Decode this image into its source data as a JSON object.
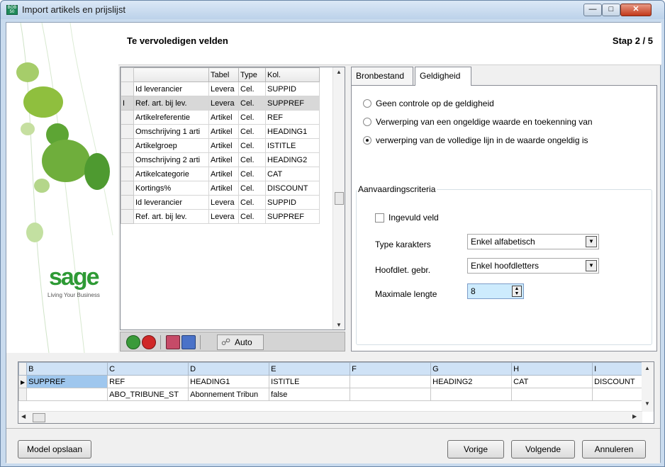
{
  "window": {
    "title": "Import artikels en prijslijst",
    "app_icon_text": "BOB 50"
  },
  "header": {
    "step_title": "Te vervoledigen velden",
    "step_number": "Stap  2 / 5"
  },
  "branding": {
    "logo": "sage",
    "tagline": "Living Your Business"
  },
  "fields_grid": {
    "columns": [
      "Tabel",
      "Type",
      "Kol."
    ],
    "rows": [
      {
        "name": "Id leverancier",
        "table": "Levera",
        "type": "Cel.",
        "col": "SUPPID"
      },
      {
        "name": "Ref. art. bij lev.",
        "table": "Levera",
        "type": "Cel.",
        "col": "SUPPREF"
      },
      {
        "name": "Artikelreferentie",
        "table": "Artikel",
        "type": "Cel.",
        "col": "REF"
      },
      {
        "name": "Omschrijving 1 arti",
        "table": "Artikel",
        "type": "Cel.",
        "col": "HEADING1"
      },
      {
        "name": "Artikelgroep",
        "table": "Artikel",
        "type": "Cel.",
        "col": "ISTITLE"
      },
      {
        "name": "Omschrijving 2 arti",
        "table": "Artikel",
        "type": "Cel.",
        "col": "HEADING2"
      },
      {
        "name": "Artikelcategorie",
        "table": "Artikel",
        "type": "Cel.",
        "col": "CAT"
      },
      {
        "name": "Kortings%",
        "table": "Artikel",
        "type": "Cel.",
        "col": "DISCOUNT"
      },
      {
        "name": "Id leverancier",
        "table": "Levera",
        "type": "Cel.",
        "col": "SUPPID"
      },
      {
        "name": "Ref. art. bij lev.",
        "table": "Levera",
        "type": "Cel.",
        "col": "SUPPREF"
      }
    ],
    "selected_row_marker": "I"
  },
  "toolbar": {
    "auto_label": "Auto"
  },
  "tabs": {
    "source": "Bronbestand",
    "validity": "Geldigheid"
  },
  "validity": {
    "options": [
      "Geen controle op de geldigheid",
      "Verwerping van een ongeldige waarde en toekenning van",
      "verwerping van de volledige lijn in de waarde ongeldig is"
    ],
    "selected_index": 2,
    "criteria_title": "Aanvaardingscriteria",
    "filled_label": "Ingevuld veld",
    "char_type_label": "Type karakters",
    "char_type_value": "Enkel alfabetisch",
    "case_label": "Hoofdlet. gebr.",
    "case_value": "Enkel hoofdletters",
    "maxlen_label": "Maximale lengte",
    "maxlen_value": "8"
  },
  "preview_grid": {
    "columns": [
      "B",
      "C",
      "D",
      "E",
      "F",
      "G",
      "H",
      "I"
    ],
    "rows": [
      [
        "SUPPREF",
        "REF",
        "HEADING1",
        "ISTITLE",
        "",
        "HEADING2",
        "CAT",
        "DISCOUNT"
      ],
      [
        "",
        "ABO_TRIBUNE_ST",
        "Abonnement Tribun",
        "false",
        "",
        "",
        "",
        ""
      ]
    ]
  },
  "footer": {
    "save_model": "Model opslaan",
    "previous": "Vorige",
    "next": "Volgende",
    "cancel": "Annuleren"
  },
  "colors": {
    "sage_green": "#2e9a35",
    "selection_blue": "#9fc7ee",
    "close_red": "#c2381a"
  }
}
